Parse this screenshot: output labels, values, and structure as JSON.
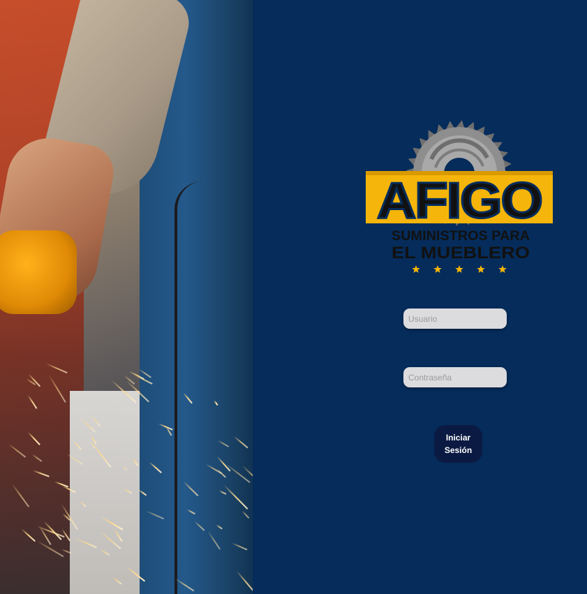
{
  "hero_image": {
    "icon": "welder-grinder-sparks-photo"
  },
  "logo": {
    "brand_name": "AFIGO",
    "tagline_line1": "SUMINISTROS PARA",
    "tagline_line2": "EL MUEBLERO",
    "icon": "saw-blade-icon",
    "star_count": 5,
    "colors": {
      "brand_yellow": "#f5b50a",
      "blade_gray": "#9a9a9a",
      "text_black": "#111111"
    }
  },
  "login_form": {
    "username": {
      "placeholder": "Usuario",
      "value": ""
    },
    "password": {
      "placeholder": "Contraseña",
      "value": ""
    },
    "submit_label": "Iniciar Sesión"
  },
  "colors": {
    "panel_background": "#052c5b",
    "input_background": "#dcdcde",
    "button_background": "#0b1a42",
    "button_text": "#ffffff"
  }
}
